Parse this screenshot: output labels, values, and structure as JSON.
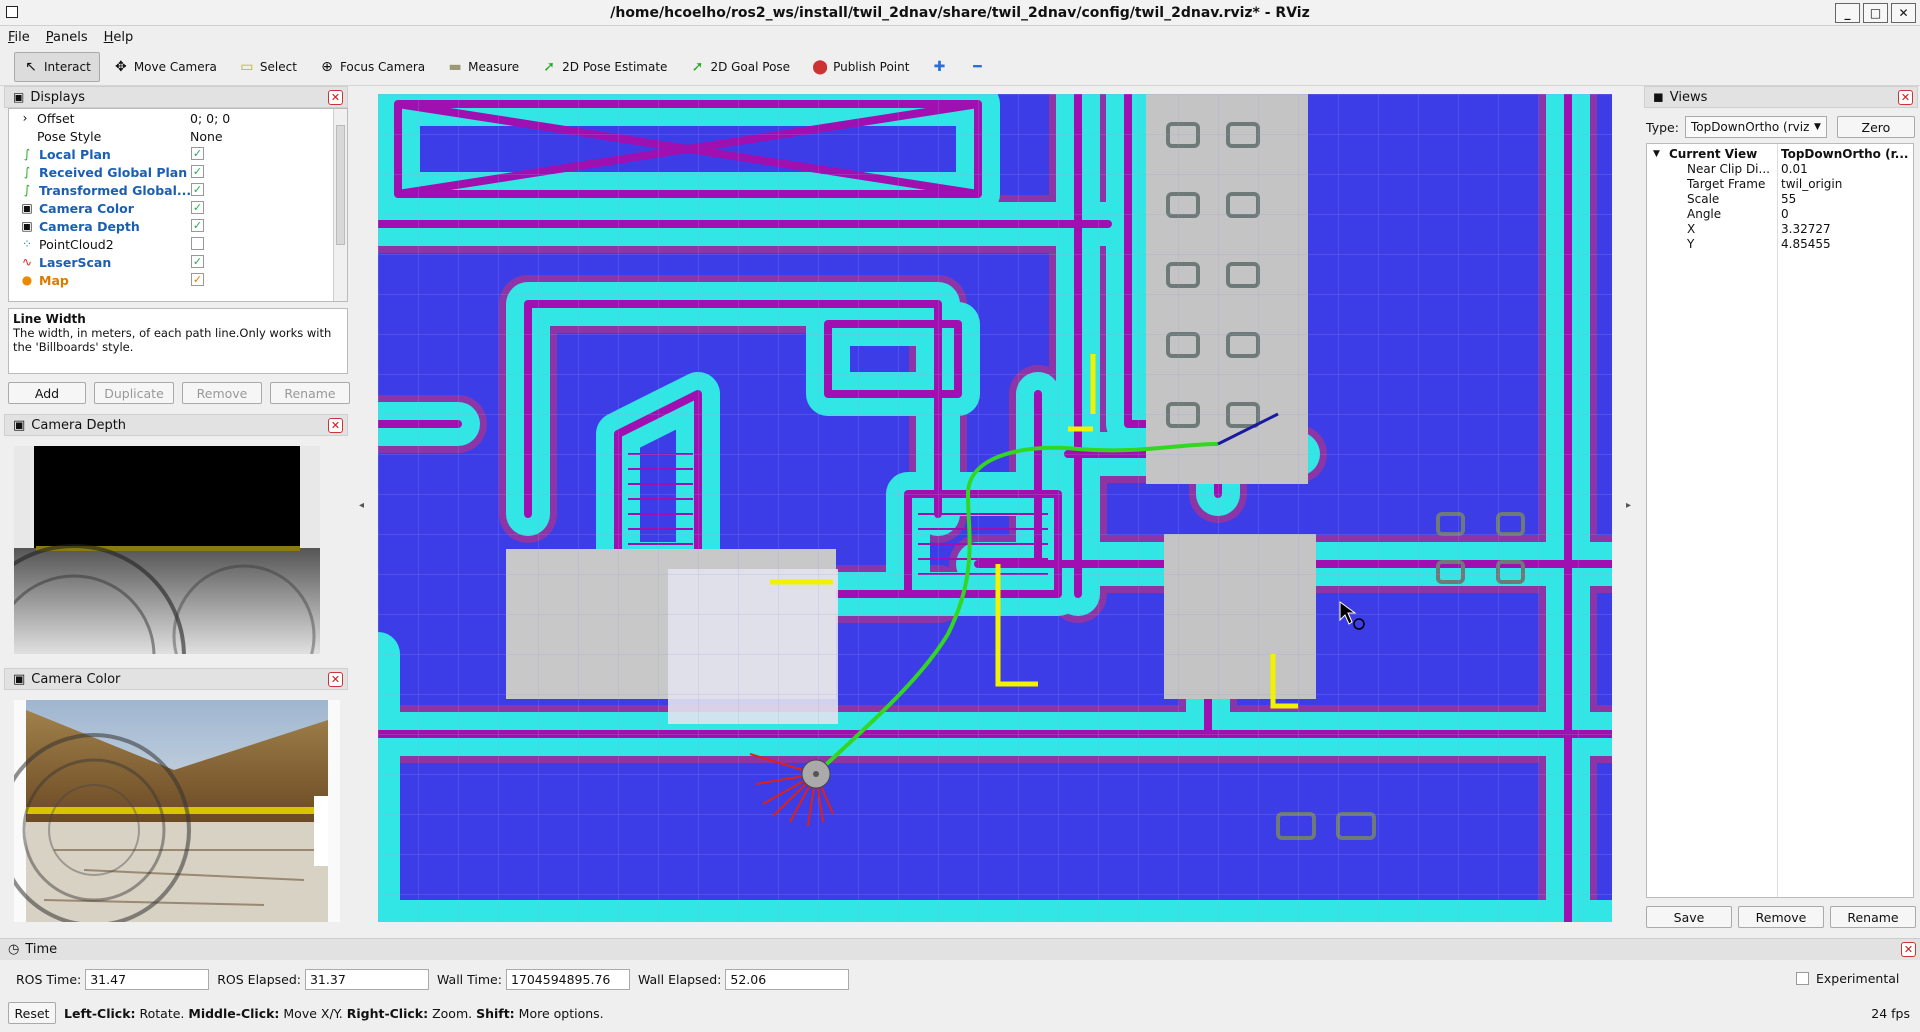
{
  "window": {
    "title": "/home/hcoelho/ros2_ws/install/twil_2dnav/share/twil_2dnav/config/twil_2dnav.rviz* - RViz"
  },
  "menu": [
    "File",
    "Panels",
    "Help"
  ],
  "toolbar": {
    "interact": "Interact",
    "move_camera": "Move Camera",
    "select": "Select",
    "focus_camera": "Focus Camera",
    "measure": "Measure",
    "pose_estimate": "2D Pose Estimate",
    "goal_pose": "2D Goal Pose",
    "publish_point": "Publish Point"
  },
  "displays": {
    "title": "Displays",
    "rows": [
      {
        "label": "Offset",
        "value": "0; 0; 0"
      },
      {
        "label": "Pose Style",
        "value": "None"
      },
      {
        "label": "Local Plan",
        "checked": "✓"
      },
      {
        "label": "Received Global Plan",
        "checked": "✓"
      },
      {
        "label": "Transformed Global...",
        "checked": "✓"
      },
      {
        "label": "Camera Color",
        "checked": "✓"
      },
      {
        "label": "Camera Depth",
        "checked": "✓"
      },
      {
        "label": "PointCloud2",
        "checked": ""
      },
      {
        "label": "LaserScan",
        "checked": "✓"
      },
      {
        "label": "Map",
        "checked": "✓"
      }
    ],
    "desc_title": "Line Width",
    "desc_text": "The width, in meters, of each path line.Only works with the 'Billboards' style.",
    "buttons": {
      "add": "Add",
      "duplicate": "Duplicate",
      "remove": "Remove",
      "rename": "Rename"
    }
  },
  "camera_depth": {
    "title": "Camera Depth"
  },
  "camera_color": {
    "title": "Camera Color"
  },
  "views": {
    "title": "Views",
    "type_label": "Type:",
    "type_value": "TopDownOrtho (rviz",
    "zero": "Zero",
    "current_view": "Current View",
    "current_view_type": "TopDownOrtho (r...",
    "props": [
      {
        "k": "Near Clip Di...",
        "v": "0.01"
      },
      {
        "k": "Target Frame",
        "v": "twil_origin"
      },
      {
        "k": "Scale",
        "v": "55"
      },
      {
        "k": "Angle",
        "v": "0"
      },
      {
        "k": "X",
        "v": "3.32727"
      },
      {
        "k": "Y",
        "v": "4.85455"
      }
    ],
    "buttons": {
      "save": "Save",
      "remove": "Remove",
      "rename": "Rename"
    }
  },
  "time": {
    "title": "Time",
    "ros_time_label": "ROS Time:",
    "ros_time": "31.47",
    "ros_elapsed_label": "ROS Elapsed:",
    "ros_elapsed": "31.37",
    "wall_time_label": "Wall Time:",
    "wall_time": "1704594895.76",
    "wall_elapsed_label": "Wall Elapsed:",
    "wall_elapsed": "52.06",
    "experimental": "Experimental"
  },
  "status": {
    "reset": "Reset",
    "lc": "Left-Click:",
    "lc_t": " Rotate. ",
    "mc": "Middle-Click:",
    "mc_t": " Move X/Y. ",
    "rc": "Right-Click:",
    "rc_t": " Zoom. ",
    "sh": "Shift:",
    "sh_t": " More options.",
    "fps": "24 fps"
  },
  "colors": {
    "costmap_bg": "#3d3de8",
    "inflation": "#33e6e6",
    "obstacle": "#a010b0",
    "path": "#33d622",
    "transformed_plan": "#f2f200",
    "laser": "#e02010"
  }
}
